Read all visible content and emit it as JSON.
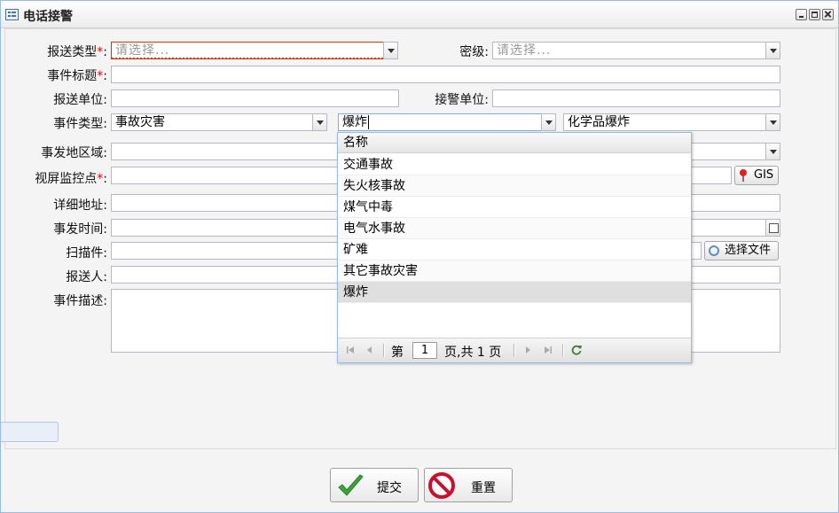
{
  "window": {
    "title": "电话接警"
  },
  "form": {
    "report_type": {
      "label": "报送类型",
      "placeholder": "请选择..."
    },
    "secret_level": {
      "label": "密级:",
      "placeholder": "请选择..."
    },
    "event_title": {
      "label": "事件标题"
    },
    "report_unit": {
      "label": "报送单位:"
    },
    "receive_unit": {
      "label": "接警单位:"
    },
    "event_type": {
      "label": "事件类型:",
      "value1": "事故灾害",
      "value2": "爆炸",
      "value3": "化学品爆炸"
    },
    "region": {
      "label": "事发地区域:"
    },
    "monitor_point": {
      "label": "视屏监控点",
      "gis_button": "GIS"
    },
    "address": {
      "label": "详细地址:"
    },
    "time": {
      "label": "事发时间:"
    },
    "scan": {
      "label": "扫描件:",
      "select_file_button": "选择文件"
    },
    "reporter": {
      "label": "报送人:"
    },
    "description": {
      "label": "事件描述:"
    },
    "required_mark": "*",
    "colon": ":"
  },
  "dropdown": {
    "header": "名称",
    "items": [
      "交通事故",
      "失火核事故",
      "煤气中毒",
      "电气水事故",
      "矿难",
      "其它事故灾害",
      "爆炸"
    ],
    "selected": "爆炸",
    "pager": {
      "prefix": "第",
      "page": "1",
      "suffix": "页,共 1 页"
    }
  },
  "buttons": {
    "submit": "提交",
    "reset": "重置"
  },
  "colors": {
    "required": "#ee0000",
    "border": "#b5b8c8",
    "window_border": "#99bbe8"
  }
}
